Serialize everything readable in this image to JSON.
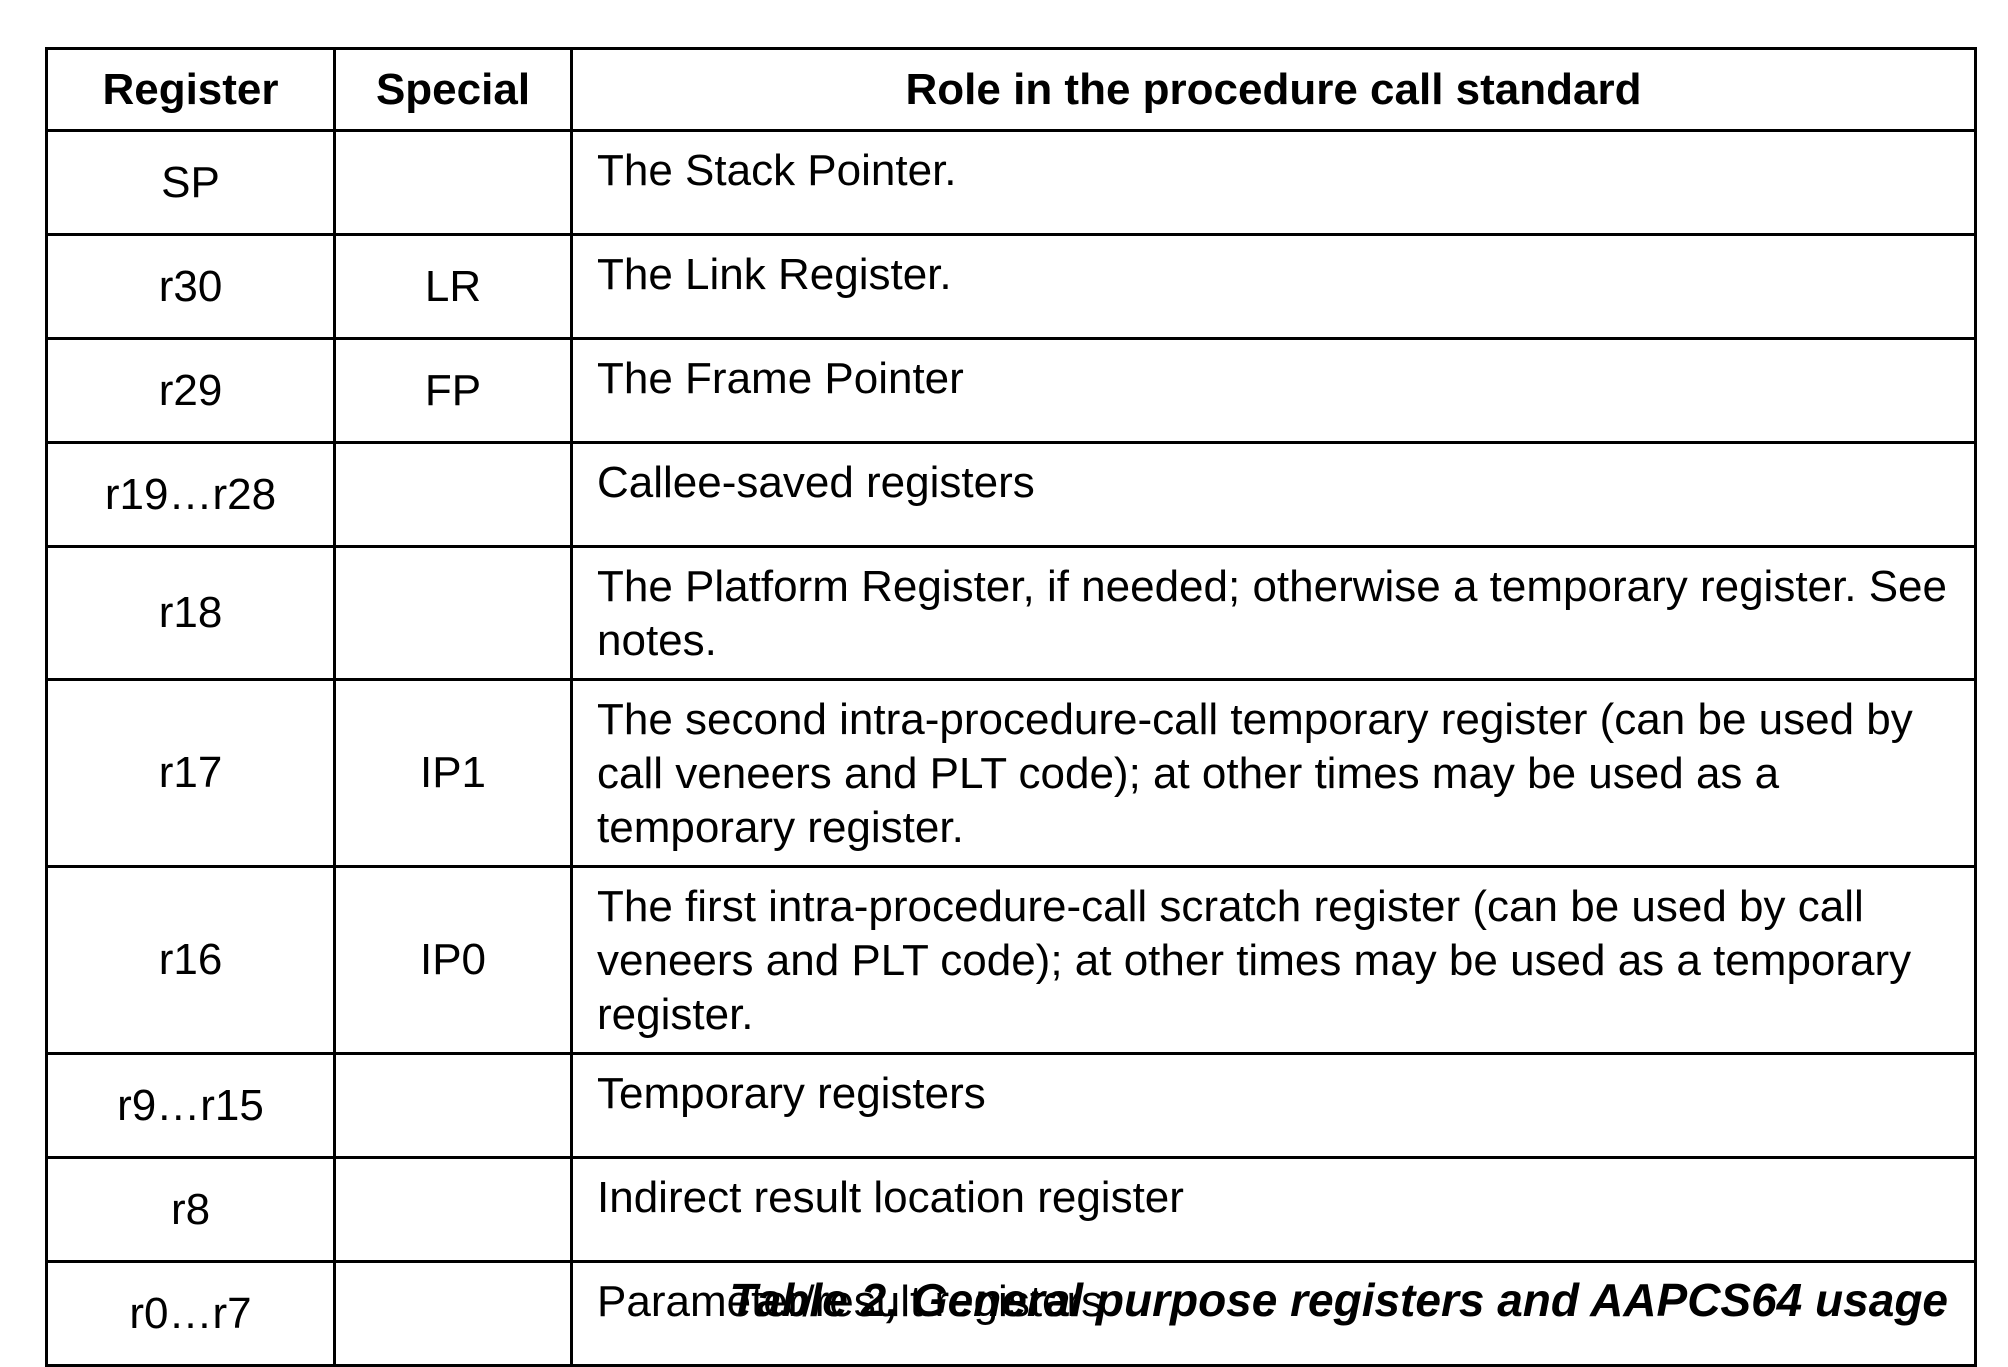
{
  "table": {
    "headers": {
      "register": "Register",
      "special": "Special",
      "role": "Role in the procedure call standard"
    },
    "rows": [
      {
        "register": "SP",
        "special": "",
        "role": "The Stack Pointer."
      },
      {
        "register": "r30",
        "special": "LR",
        "role": "The Link Register."
      },
      {
        "register": "r29",
        "special": "FP",
        "role": "The Frame Pointer"
      },
      {
        "register": "r19…r28",
        "special": "",
        "role": "Callee-saved registers"
      },
      {
        "register": "r18",
        "special": "",
        "role": "The Platform Register, if needed; otherwise a temporary register. See notes."
      },
      {
        "register": "r17",
        "special": "IP1",
        "role": "The second intra-procedure-call temporary register (can be used by call veneers and PLT code); at other times may be used as a temporary register."
      },
      {
        "register": "r16",
        "special": "IP0",
        "role": "The first intra-procedure-call scratch register (can be used by call veneers and PLT code); at other times may be used as a temporary register."
      },
      {
        "register": "r9…r15",
        "special": "",
        "role": "Temporary registers"
      },
      {
        "register": "r8",
        "special": "",
        "role": "Indirect result location register"
      },
      {
        "register": "r0…r7",
        "special": "",
        "role": "Parameter/result registers"
      }
    ]
  },
  "caption": "Table 2, General purpose registers and AAPCS64 usage"
}
